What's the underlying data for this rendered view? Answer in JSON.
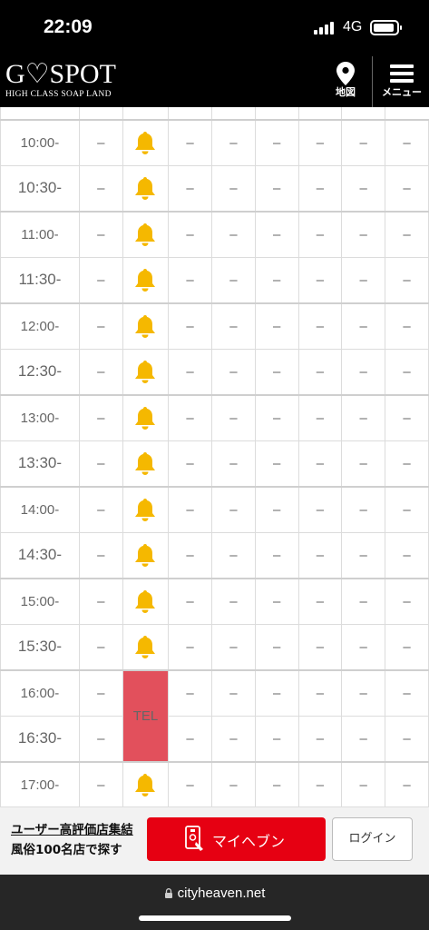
{
  "status": {
    "time": "22:09",
    "network": "4G"
  },
  "header": {
    "logo_main": "G♡SPOT",
    "logo_sub": "HIGH CLASS SOAP LAND",
    "map_label": "地図",
    "menu_label": "メニュー"
  },
  "schedule": {
    "empty_mark": "–",
    "tel_label": "TEL",
    "rows": [
      {
        "time": "10:00-",
        "col2": "bell"
      },
      {
        "time": "10:30-",
        "col2": "bell"
      },
      {
        "time": "11:00-",
        "col2": "bell"
      },
      {
        "time": "11:30-",
        "col2": "bell"
      },
      {
        "time": "12:00-",
        "col2": "bell"
      },
      {
        "time": "12:30-",
        "col2": "bell"
      },
      {
        "time": "13:00-",
        "col2": "bell"
      },
      {
        "time": "13:30-",
        "col2": "bell"
      },
      {
        "time": "14:00-",
        "col2": "bell"
      },
      {
        "time": "14:30-",
        "col2": "bell"
      },
      {
        "time": "15:00-",
        "col2": "bell"
      },
      {
        "time": "15:30-",
        "col2": "bell"
      },
      {
        "time": "16:00-",
        "col2": "tel"
      },
      {
        "time": "16:30-",
        "col2": "tel"
      },
      {
        "time": "17:00-",
        "col2": "bell"
      }
    ],
    "accent_tel": "#e2505c",
    "bell_color": "#f5b800"
  },
  "banner": {
    "line1": "ユーザー高評価店集結",
    "line2": "風俗100名店で探す",
    "myheaven_label": "マイヘブン",
    "login_label": "ログイン"
  },
  "browser": {
    "url": "cityheaven.net"
  }
}
